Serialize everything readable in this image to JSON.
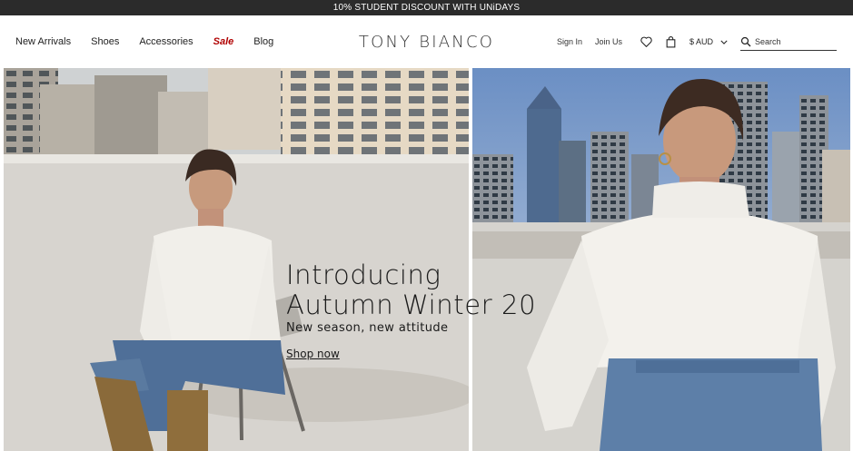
{
  "promo": {
    "text": "10% STUDENT DISCOUNT WITH UNiDAYS"
  },
  "nav": {
    "items": [
      {
        "label": "New Arrivals"
      },
      {
        "label": "Shoes"
      },
      {
        "label": "Accessories"
      },
      {
        "label": "Sale"
      },
      {
        "label": "Blog"
      }
    ]
  },
  "logo": {
    "text": "TONY BIANCO"
  },
  "utility": {
    "sign_in": "Sign In",
    "join_us": "Join Us",
    "wishlist_icon": "heart-icon",
    "bag_icon": "shopping-bag-icon",
    "currency": "$ AUD",
    "search_placeholder": "Search"
  },
  "hero": {
    "title_line1": "Introducing",
    "title_line2": "Autumn Winter 20",
    "subtitle": "New season, new attitude",
    "cta": "Shop now"
  },
  "colors": {
    "promo_bg": "#2b2b2b",
    "sale": "#b00000",
    "text": "#222222"
  }
}
